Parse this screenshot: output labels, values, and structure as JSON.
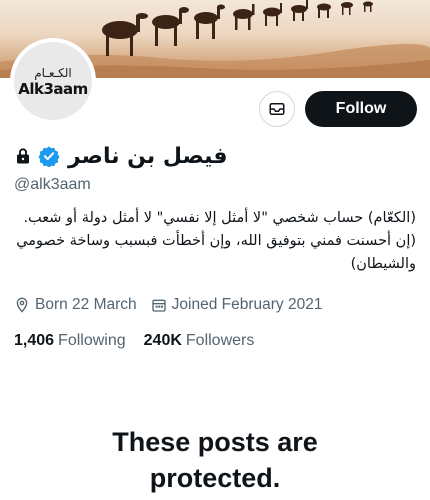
{
  "profile": {
    "display_name": "فيصل بن ناصر",
    "handle": "@alk3aam",
    "verified": true,
    "protected": true,
    "avatar_text_ar": "الكـعـام",
    "avatar_text_en": "Alk3aam",
    "bio_line1": "(الكعّام) حساب شخصي \"لا أمثل إلا نفسي\" لا أمثل دولة أو شعب.",
    "bio_line2": "(إن أحسنت فمني بتوفيق الله، وإن أخطأت فبسبب وساخة خصومي",
    "bio_line3": "والشيطان)",
    "born": "Born 22 March",
    "joined": "Joined February 2021",
    "following_count": "1,406",
    "following_label": "Following",
    "followers_count": "240K",
    "followers_label": "Followers"
  },
  "actions": {
    "follow_label": "Follow"
  },
  "protected_message": {
    "line1": "These posts are",
    "line2": "protected."
  },
  "colors": {
    "accent_black": "#0f1419",
    "muted": "#536471",
    "verified_blue": "#1d9bf0",
    "border": "#cfd9de"
  },
  "icons": [
    "envelope-icon",
    "lock-icon",
    "verified-badge-icon",
    "location-pin-icon",
    "calendar-icon"
  ]
}
